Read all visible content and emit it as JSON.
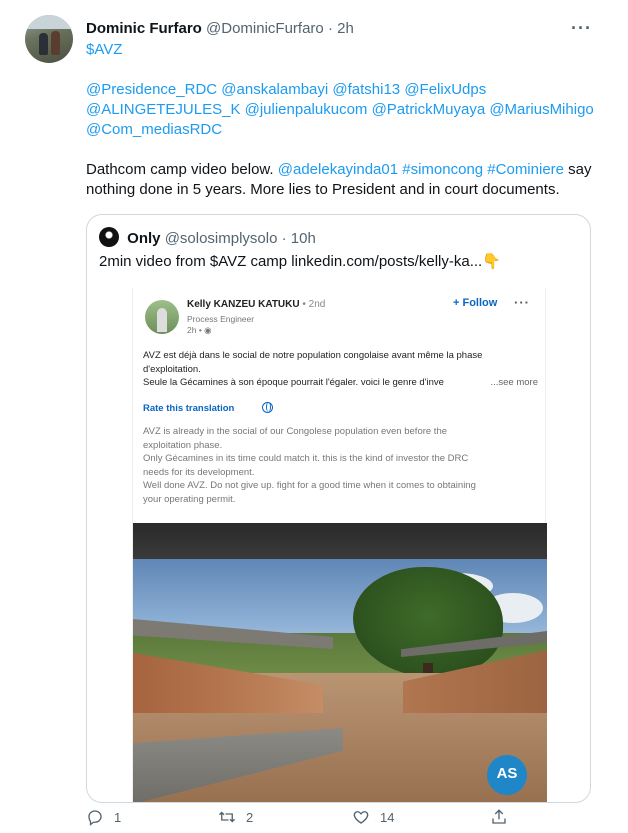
{
  "tweet": {
    "author_name": "Dominic Furfaro",
    "author_handle": "@DominicFurfaro",
    "separator": "·",
    "time": "2h",
    "more_icon": "more-horizontal-icon",
    "ticker": "$AVZ",
    "mentions_line1": "@Presidence_RDC @anskalambayi @fatshi13 @FelixUdps",
    "mentions_line2": "@ALINGETEJULES_K @julienpalukucom @PatrickMuyaya  @MariusMihigo",
    "mentions_line3": "@Com_mediasRDC",
    "text_a": "Dathcom camp video below. ",
    "tags": "@adelekayinda01 #simoncong #Cominiere",
    "text_b": " say",
    "text_line2": "nothing done in 5 years. More lies to President and in court documents."
  },
  "quote": {
    "author_name": "Only",
    "author_handle": "@solosimplysolo",
    "separator": "·",
    "time": "10h",
    "text": "2min video from $AVZ camp   linkedin.com/posts/kelly-ka...",
    "emoji": "👇"
  },
  "linkedin": {
    "name": "Kelly KANZEU KATUKU",
    "degree": "• 2nd",
    "title": "Process Engineer",
    "time": "2h • ",
    "follow_label": "+ Follow",
    "more_icon": "more-horizontal-icon",
    "fr_line1": "AVZ est déjà dans le social de notre population congolaise avant même la phase",
    "fr_line2": "d'exploitation.",
    "fr_line3": "Seule la Gécamines à son époque pourrait l'égaler. voici le genre d'inve",
    "see_more": "...see more",
    "rate_translation": "Rate this translation",
    "en_line1": "AVZ is already in the social of our Congolese population even before the",
    "en_line2": "exploitation phase.",
    "en_line3": "Only Gécamines in its time could match it. this is the kind of investor the DRC",
    "en_line4": "needs for its development.",
    "en_line5": "Well done AVZ. Do not give up. fight for a good time when it comes to obtaining",
    "en_line6": "your operating permit.",
    "video_logo": "AS"
  },
  "actions": {
    "reply_count": "1",
    "retweet_count": "2",
    "like_count": "14"
  },
  "colors": {
    "link": "#1d9bf0",
    "muted": "#536471",
    "linkedin_blue": "#0a66c2",
    "border": "#cfd9de"
  }
}
